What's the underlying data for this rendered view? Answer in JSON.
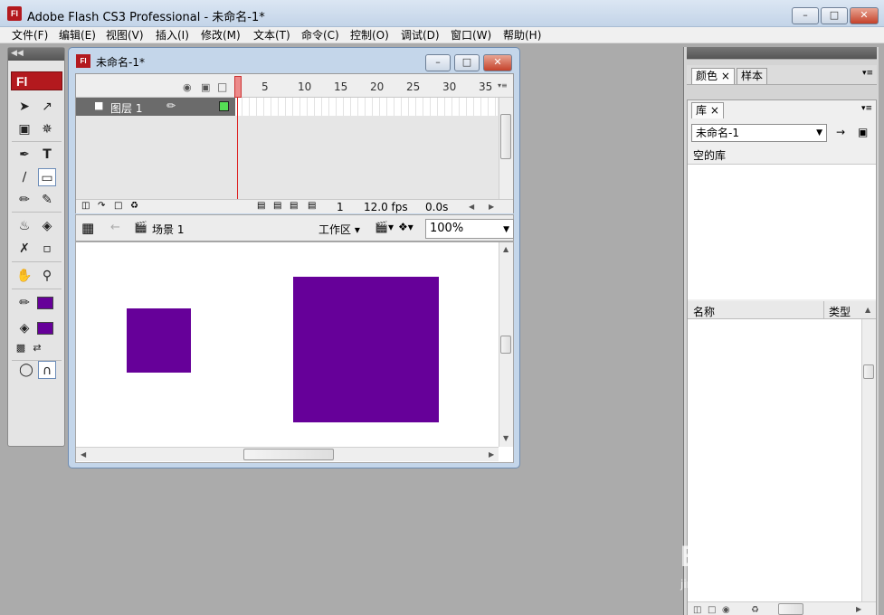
{
  "app": {
    "icon_text": "Fl",
    "title": "Adobe Flash CS3 Professional - 未命名-1*"
  },
  "menu": [
    "文件(F)",
    "编辑(E)",
    "视图(V)",
    "插入(I)",
    "修改(M)",
    "文本(T)",
    "命令(C)",
    "控制(O)",
    "调试(D)",
    "窗口(W)",
    "帮助(H)"
  ],
  "tools": {
    "logo": "Fl",
    "stroke_color": "#660099",
    "fill_color": "#660099"
  },
  "document": {
    "title": "未命名-1*",
    "timeline": {
      "frame_numbers": [
        "5",
        "10",
        "15",
        "20",
        "25",
        "30",
        "35"
      ],
      "layer_name": "图层 1",
      "current_frame": "1",
      "fps": "12.0 fps",
      "time": "0.0s"
    },
    "editbar": {
      "scene": "场景 1",
      "workspace": "工作区",
      "zoom": "100%"
    },
    "stage": {
      "shape_color": "#660099"
    }
  },
  "right": {
    "color_tabs": [
      "颜色",
      "样本"
    ],
    "library_tab": "库",
    "library_doc": "未命名-1",
    "library_empty": "空的库",
    "col_name": "名称",
    "col_type": "类型"
  },
  "watermark": {
    "logo": "Baidu经验",
    "url": "jingyan.baidu.com"
  }
}
